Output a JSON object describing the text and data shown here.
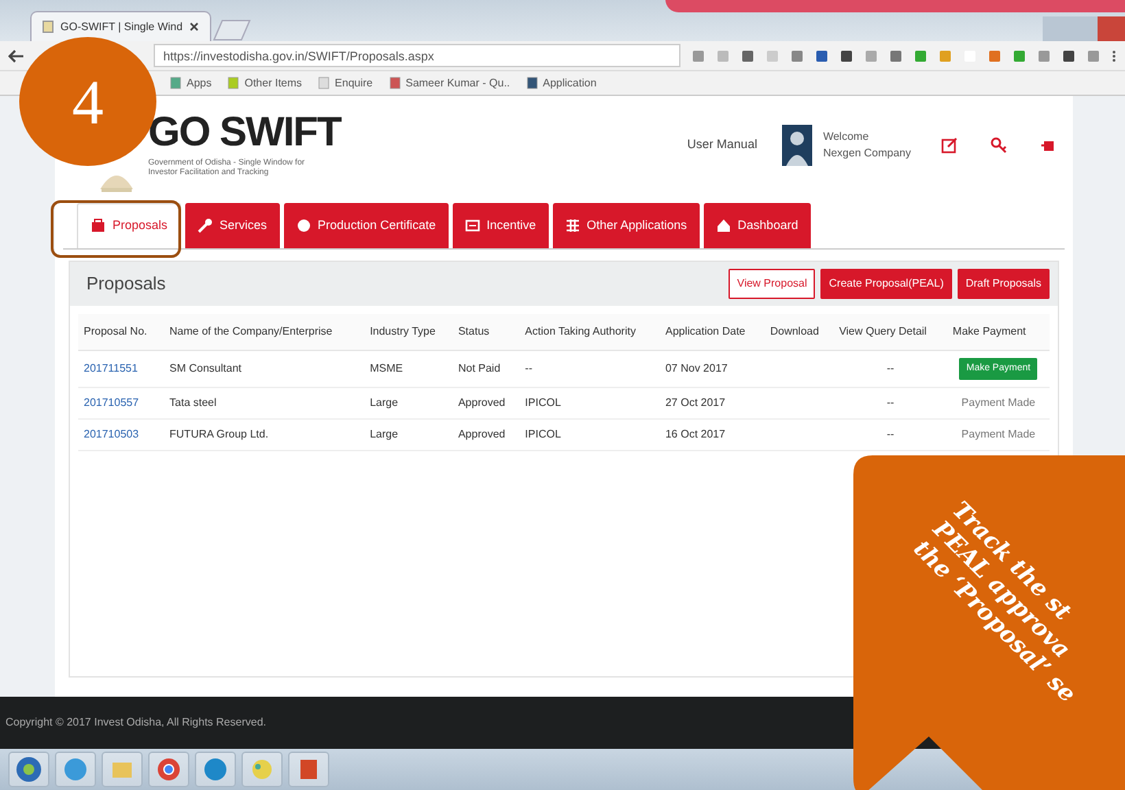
{
  "browser": {
    "tab_title": "GO-SWIFT | Single Wind",
    "url": "https://investodisha.gov.in/SWIFT/Proposals.aspx",
    "bookmarks": [
      "Apps",
      "Other Items",
      "Enquire",
      "Sameer Kumar - Qu..",
      "Application"
    ]
  },
  "header": {
    "logo_title": "GO SWIFT",
    "logo_subtitle": "Government of Odisha - Single Window for Investor Facilitation and Tracking",
    "user_manual": "User Manual",
    "welcome": "Welcome",
    "user_name": "Nexgen Company"
  },
  "nav_tabs": [
    {
      "label": "Proposals",
      "selected": true
    },
    {
      "label": "Services",
      "selected": false
    },
    {
      "label": "Production Certificate",
      "selected": false
    },
    {
      "label": "Incentive",
      "selected": false
    },
    {
      "label": "Other Applications",
      "selected": false
    },
    {
      "label": "Dashboard",
      "selected": false
    }
  ],
  "panel": {
    "title": "Proposals",
    "buttons": [
      {
        "label": "View Proposal",
        "kind": "outline"
      },
      {
        "label": "Create Proposal(PEAL)",
        "kind": "solid"
      },
      {
        "label": "Draft Proposals",
        "kind": "solid"
      }
    ]
  },
  "table": {
    "columns": [
      "Proposal No.",
      "Name of the Company/Enterprise",
      "Industry Type",
      "Status",
      "Action Taking Authority",
      "Application Date",
      "Download",
      "View Query Detail",
      "Make Payment"
    ],
    "rows": [
      {
        "proposal_no": "201711551",
        "company": "SM Consultant",
        "industry_type": "MSME",
        "status": "Not Paid",
        "authority": "--",
        "date": "07 Nov 2017",
        "query": "--",
        "payment": {
          "kind": "button",
          "label": "Make Payment"
        }
      },
      {
        "proposal_no": "201710557",
        "company": "Tata steel",
        "industry_type": "Large",
        "status": "Approved",
        "authority": "IPICOL",
        "date": "27 Oct 2017",
        "query": "--",
        "payment": {
          "kind": "text",
          "label": "Payment Made"
        }
      },
      {
        "proposal_no": "201710503",
        "company": "FUTURA Group Ltd.",
        "industry_type": "Large",
        "status": "Approved",
        "authority": "IPICOL",
        "date": "16 Oct 2017",
        "query": "--",
        "payment": {
          "kind": "text",
          "label": "Payment Made"
        }
      }
    ]
  },
  "footer": "Copyright © 2017 Invest Odisha, All Rights Reserved.",
  "slide": {
    "step_number": "4",
    "callout_lines": [
      "Track the st",
      "PEAL approva",
      "the ‘Proposal’ se"
    ]
  }
}
